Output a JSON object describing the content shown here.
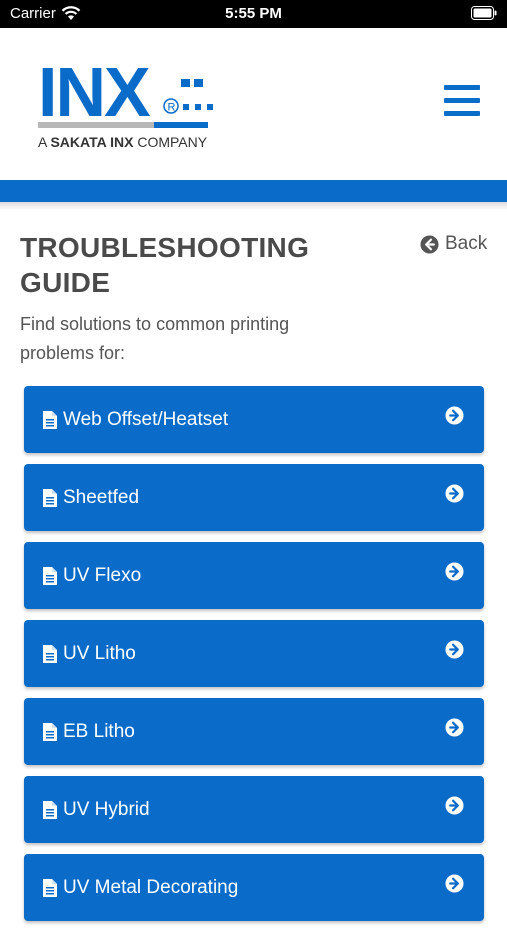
{
  "status_bar": {
    "carrier": "Carrier",
    "time": "5:55 PM"
  },
  "header": {
    "logo_text": "INX",
    "logo_tagline_prefix": "A ",
    "logo_tagline_bold": "SAKATA INX",
    "logo_tagline_suffix": " COMPANY",
    "menu_icon": "hamburger-icon"
  },
  "colors": {
    "brand_blue": "#0b6bc9",
    "gray_bar": "#b8b8b8"
  },
  "page": {
    "title": "TROUBLESHOOTING GUIDE",
    "back_label": "Back",
    "subtitle": "Find solutions to common printing problems for:"
  },
  "categories": [
    {
      "label": "Web Offset/Heatset"
    },
    {
      "label": "Sheetfed"
    },
    {
      "label": "UV Flexo"
    },
    {
      "label": "UV Litho"
    },
    {
      "label": "EB Litho"
    },
    {
      "label": "UV Hybrid"
    },
    {
      "label": "UV Metal Decorating"
    }
  ]
}
